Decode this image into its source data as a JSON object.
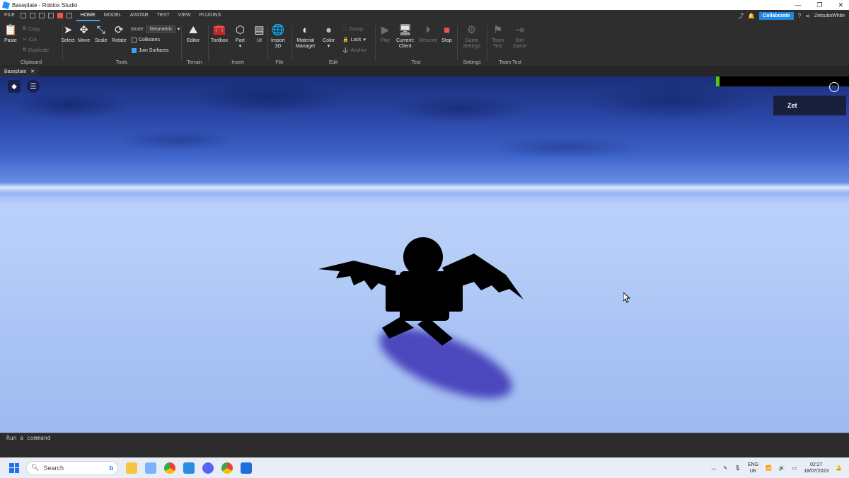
{
  "window": {
    "title": "Baseplate - Roblox Studio"
  },
  "menu": {
    "file": "FILE",
    "tabs": [
      "HOME",
      "MODEL",
      "AVATAR",
      "TEST",
      "VIEW",
      "PLUGINS"
    ],
    "collaborate": "Collaborate",
    "user": "ZetsuboWhite"
  },
  "ribbon": {
    "clipboard": {
      "label": "Clipboard",
      "paste": "Paste",
      "copy": "Copy",
      "cut": "Cut",
      "duplicate": "Duplicate"
    },
    "tools": {
      "label": "Tools",
      "select": "Select",
      "move": "Move",
      "scale": "Scale",
      "rotate": "Rotate",
      "mode_label": "Mode:",
      "mode_value": "Geometric",
      "collisions": "Collisions",
      "join_surfaces": "Join Surfaces"
    },
    "terrain": {
      "label": "Terrain",
      "editor": "Editor"
    },
    "insert": {
      "label": "Insert",
      "toolbox": "Toolbox",
      "part": "Part",
      "ui": "UI"
    },
    "file": {
      "label": "File",
      "import": "Import\n3D"
    },
    "edit": {
      "label": "Edit",
      "material": "Material\nManager",
      "color": "Color",
      "group": "Group",
      "lock": "Lock",
      "anchor": "Anchor"
    },
    "test": {
      "label": "Test",
      "play": "Play",
      "current_client": "Current:\nClient",
      "resume": "Resume",
      "stop": "Stop"
    },
    "settings": {
      "label": "Settings",
      "game_settings": "Game\nSettings"
    },
    "team_test": {
      "label": "Team Test",
      "team_test": "Team\nTest",
      "exit_game": "Exit\nGame"
    }
  },
  "doc_tab": {
    "label": "Baseplate",
    "close": "✕"
  },
  "viewport": {
    "player_name": "Zet"
  },
  "command_bar": {
    "placeholder": "Run a command"
  },
  "taskbar": {
    "search": "Search",
    "lang": "ENG",
    "region": "UK",
    "time": "02:27",
    "date": "18/07/2023"
  },
  "colors": {
    "accent": "#1e88e5",
    "stop": "#e85454",
    "status_green": "#5ac40f"
  }
}
